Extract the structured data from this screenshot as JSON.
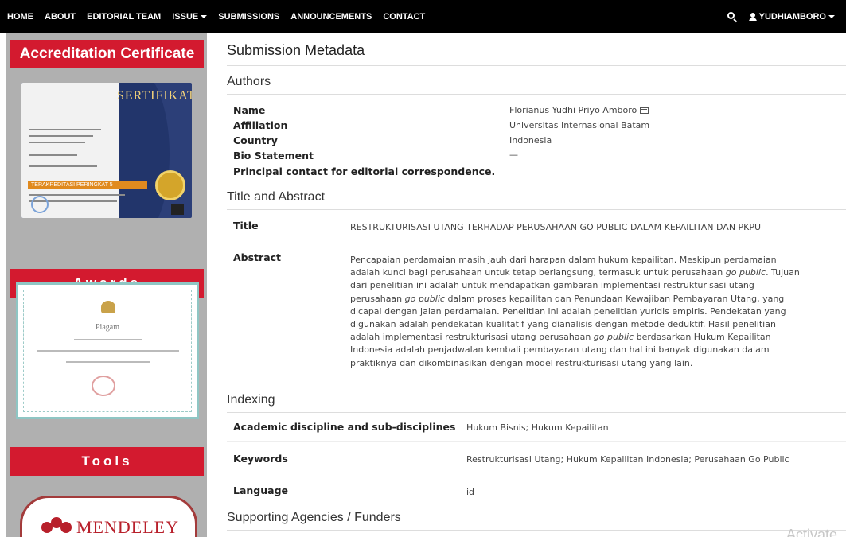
{
  "nav": {
    "items": [
      {
        "label": "HOME"
      },
      {
        "label": "ABOUT"
      },
      {
        "label": "EDITORIAL TEAM"
      },
      {
        "label": "ISSUE",
        "dropdown": true
      },
      {
        "label": "SUBMISSIONS"
      },
      {
        "label": "ANNOUNCEMENTS"
      },
      {
        "label": "CONTACT"
      }
    ],
    "user": "YUDHIAMBORO",
    "search_icon": "search-icon",
    "user_icon": "user-icon"
  },
  "sidebar": {
    "accreditation_title": "Accreditation Certificate",
    "certificate_heading": "SERTIFIKAT",
    "certificate_strip": "TERAKREDITASI PERINGKAT 5",
    "awards_title": "Awards",
    "piagam_title": "Piagam",
    "tools_title": "Tools",
    "mendeley_label": "MENDELEY"
  },
  "main": {
    "page_title": "Submission Metadata",
    "authors": {
      "heading": "Authors",
      "fields": [
        {
          "label": "Name",
          "value": "Florianus Yudhi Priyo Amboro"
        },
        {
          "label": "Affiliation",
          "value": "Universitas Internasional Batam"
        },
        {
          "label": "Country",
          "value": "Indonesia"
        },
        {
          "label": "Bio Statement",
          "value": "—"
        }
      ],
      "principal_contact": "Principal contact for editorial correspondence."
    },
    "title_abstract": {
      "heading": "Title and Abstract",
      "title_label": "Title",
      "title_value": "RESTRUKTURISASI UTANG TERHADAP PERUSAHAAN GO PUBLIC DALAM KEPAILITAN DAN PKPU",
      "abstract_label": "Abstract",
      "abstract_lines": [
        "Pencapaian perdamaian masih jauh dari harapan dalam hukum kepailitan. Meskipun perdamaian",
        "adalah kunci bagi perusahaan untuk tetap berlangsung, termasuk untuk perusahaan |go public|. Tujuan",
        "dari penelitian ini adalah untuk mendapatkan gambaran implementasi restrukturisasi utang",
        "perusahaan |go public| dalam proses kepailitan dan Penundaan Kewajiban Pembayaran Utang, yang",
        "dicapai dengan jalan perdamaian. Penelitian ini adalah penelitian yuridis empiris. Pendekatan yang",
        "digunakan adalah pendekatan kualitatif yang dianalisis dengan metode deduktif. Hasil penelitian",
        "adalah implementasi restrukturisasi utang perusahaan |go public| berdasarkan Hukum Kepailitan",
        "Indonesia adalah penjadwalan kembali pembayaran utang dan hal ini banyak digunakan dalam",
        "praktiknya dan dikombinasikan dengan model restrukturisasi utang yang lain."
      ]
    },
    "indexing": {
      "heading": "Indexing",
      "discipline_label": "Academic discipline and sub-disciplines",
      "discipline_value": "Hukum Bisnis; Hukum Kepailitan",
      "keywords_label": "Keywords",
      "keywords_value": "Restrukturisasi Utang; Hukum Kepailitan Indonesia; Perusahaan Go Public",
      "language_label": "Language",
      "language_value": "id"
    },
    "supporting_heading": "Supporting Agencies / Funders"
  },
  "watermark": "Activate",
  "colors": {
    "nav_bg": "#000000",
    "sidebar_bg": "#b0b0b0",
    "accent_red": "#d31a2f"
  }
}
